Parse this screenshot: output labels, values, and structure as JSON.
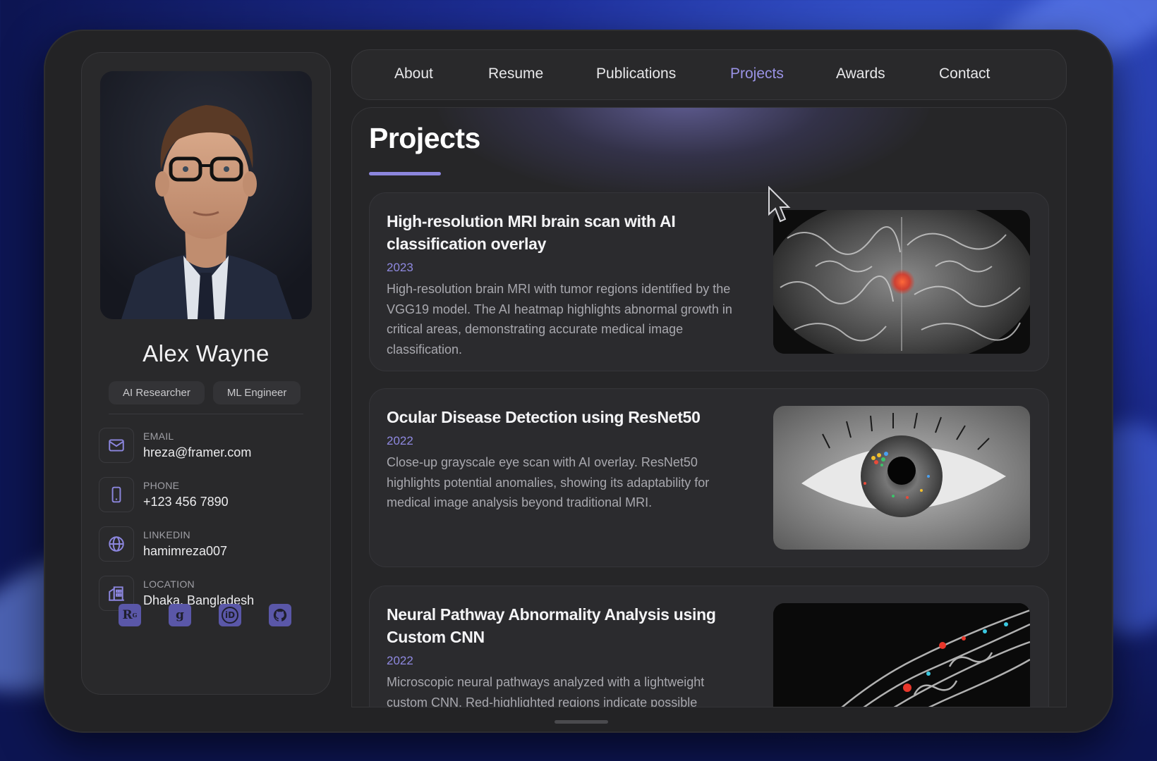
{
  "profile": {
    "name": "Alex Wayne",
    "tags": [
      "AI Researcher",
      "ML Engineer"
    ],
    "contacts": [
      {
        "label": "EMAIL",
        "value": "hreza@framer.com",
        "icon": "mail-icon"
      },
      {
        "label": "PHONE",
        "value": "+123 456 7890",
        "icon": "phone-icon"
      },
      {
        "label": "LINKEDIN",
        "value": "hamimreza007",
        "icon": "globe-icon"
      },
      {
        "label": "LOCATION",
        "value": "Dhaka, Bangladesh",
        "icon": "building-icon"
      }
    ],
    "socials": [
      {
        "icon": "researchgate-icon",
        "glyph": "R"
      },
      {
        "icon": "google-scholar-icon",
        "glyph": "g"
      },
      {
        "icon": "orcid-icon",
        "glyph": "iD"
      },
      {
        "icon": "github-icon",
        "glyph": ""
      }
    ]
  },
  "nav": {
    "items": [
      "About",
      "Resume",
      "Publications",
      "Projects",
      "Awards",
      "Contact"
    ],
    "active": "Projects"
  },
  "main": {
    "title": "Projects",
    "projects": [
      {
        "title": "High-resolution MRI brain scan with AI classification overlay",
        "year": "2023",
        "description": "High-resolution brain MRI with tumor regions identified by the VGG19 model. The AI heatmap highlights abnormal growth in critical areas, demonstrating accurate medical image classification.",
        "image": "mri-brain-scan-image"
      },
      {
        "title": "Ocular Disease Detection using ResNet50",
        "year": "2022",
        "description": "Close-up grayscale eye scan with AI overlay. ResNet50 highlights potential anomalies, showing its adaptability for medical image analysis beyond traditional MRI.",
        "image": "eye-scan-image"
      },
      {
        "title": "Neural Pathway Abnormality Analysis using Custom CNN",
        "year": "2022",
        "description": "Microscopic neural pathways analyzed with a lightweight custom CNN. Red-highlighted regions indicate possible",
        "image": "neural-pathway-image"
      }
    ]
  },
  "colors": {
    "accent": "#8c86de",
    "background": "#232325",
    "card": "#2b2b2e"
  }
}
